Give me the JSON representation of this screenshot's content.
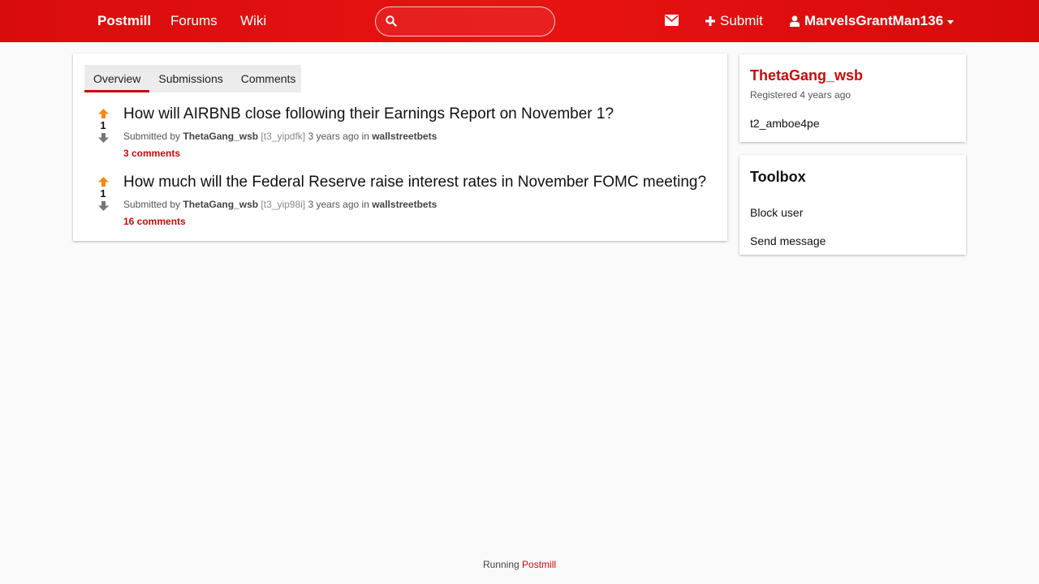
{
  "header": {
    "brand": "Postmill",
    "nav": [
      {
        "label": "Forums"
      },
      {
        "label": "Wiki"
      }
    ],
    "search": {
      "placeholder": "",
      "value": ""
    },
    "submit_label": "Submit",
    "username": "MarvelsGrantMan136",
    "icons": [
      "search-icon",
      "envelope-icon",
      "plus-icon",
      "user-icon",
      "caret-down-icon"
    ]
  },
  "tabs": [
    {
      "label": "Overview",
      "active": true
    },
    {
      "label": "Submissions",
      "active": false
    },
    {
      "label": "Comments",
      "active": false
    }
  ],
  "submissions": [
    {
      "score": "1",
      "title": "How will AIRBNB close following their Earnings Report on November 1?",
      "submitted_by": "Submitted by",
      "author": "ThetaGang_wsb",
      "id": "[t3_yipdfk]",
      "time": "3 years ago",
      "in": "in",
      "forum": "wallstreetbets",
      "comments": "3 comments"
    },
    {
      "score": "1",
      "title": "How much will the Federal Reserve raise interest rates in November FOMC meeting?",
      "submitted_by": "Submitted by",
      "author": "ThetaGang_wsb",
      "id": "[t3_yip98i]",
      "time": "3 years ago",
      "in": "in",
      "forum": "wallstreetbets",
      "comments": "16 comments"
    }
  ],
  "sidebar": {
    "profile": {
      "name": "ThetaGang_wsb",
      "registered": "Registered 4 years ago",
      "user_id": "t2_amboe4pe"
    },
    "toolbox": {
      "title": "Toolbox",
      "block_label": "Block user",
      "send_label": "Send message"
    }
  },
  "footer": {
    "running": "Running",
    "link": "Postmill"
  },
  "colors": {
    "header_bg": "#e00d0d",
    "accent": "#c30c0c",
    "upvote": "#f08a14",
    "downvote": "#777777",
    "background": "#fafafa"
  }
}
